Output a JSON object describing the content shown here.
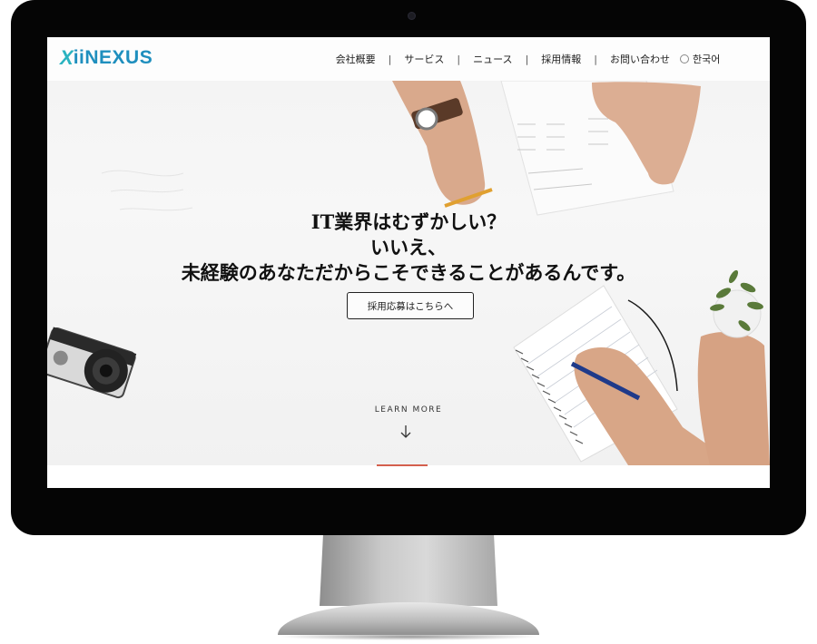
{
  "brand": {
    "logo_text": "iiNEXUS",
    "logo_mark": "X"
  },
  "nav": {
    "items": [
      "会社概要",
      "サービス",
      "ニュース",
      "採用情報",
      "お問い合わせ"
    ],
    "separator": "|",
    "language": "한국어"
  },
  "hero": {
    "line1": "IT業界はむずかしい？",
    "line2": "いいえ、",
    "line3": "未経験のあなただからこそできることがあるんです。",
    "cta_label": "採用応募はこちらへ",
    "learn_more": "LEARN MORE"
  },
  "colors": {
    "brand_blue": "#1f8fbe",
    "brand_teal": "#2bb3c0",
    "bezel": "#050505"
  },
  "icons": {
    "language": "globe-icon",
    "scroll": "arrow-down-icon"
  }
}
